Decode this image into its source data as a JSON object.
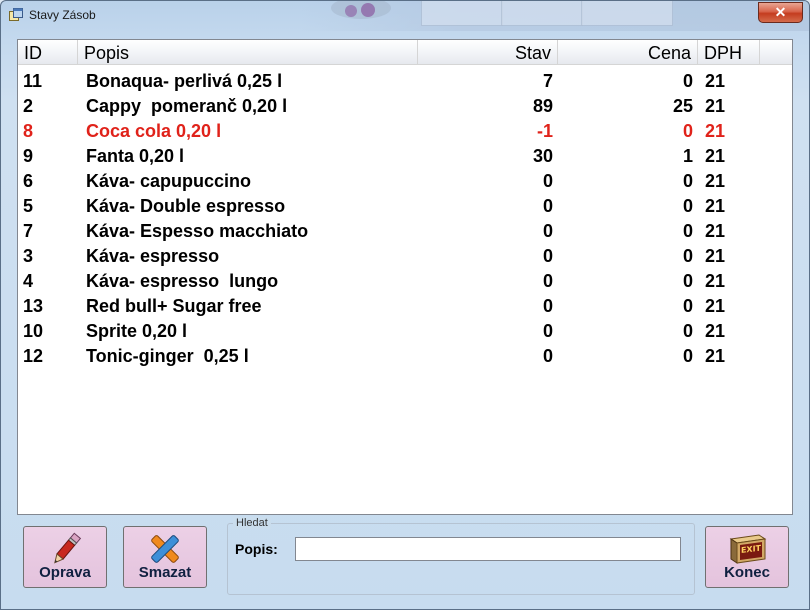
{
  "window": {
    "title": "Stavy Zásob",
    "close_glyph": "✕"
  },
  "table": {
    "headers": {
      "id": "ID",
      "popis": "Popis",
      "stav": "Stav",
      "cena": "Cena",
      "dph": "DPH"
    },
    "rows": [
      {
        "id": "11",
        "popis": "Bonaqua- perlivá 0,25 l",
        "stav": "7",
        "cena": "0",
        "dph": "21",
        "highlight": false
      },
      {
        "id": "2",
        "popis": "Cappy  pomeranč 0,20 l",
        "stav": "89",
        "cena": "25",
        "dph": "21",
        "highlight": false
      },
      {
        "id": "8",
        "popis": "Coca cola 0,20 l",
        "stav": "-1",
        "cena": "0",
        "dph": "21",
        "highlight": true
      },
      {
        "id": "9",
        "popis": "Fanta 0,20 l",
        "stav": "30",
        "cena": "1",
        "dph": "21",
        "highlight": false
      },
      {
        "id": "6",
        "popis": "Káva- capupuccino",
        "stav": "0",
        "cena": "0",
        "dph": "21",
        "highlight": false
      },
      {
        "id": "5",
        "popis": "Káva- Double espresso",
        "stav": "0",
        "cena": "0",
        "dph": "21",
        "highlight": false
      },
      {
        "id": "7",
        "popis": "Káva- Espesso macchiato",
        "stav": "0",
        "cena": "0",
        "dph": "21",
        "highlight": false
      },
      {
        "id": "3",
        "popis": "Káva- espresso",
        "stav": "0",
        "cena": "0",
        "dph": "21",
        "highlight": false
      },
      {
        "id": "4",
        "popis": "Káva- espresso  lungo",
        "stav": "0",
        "cena": "0",
        "dph": "21",
        "highlight": false
      },
      {
        "id": "13",
        "popis": "Red bull+ Sugar free",
        "stav": "0",
        "cena": "0",
        "dph": "21",
        "highlight": false
      },
      {
        "id": "10",
        "popis": "Sprite 0,20 l",
        "stav": "0",
        "cena": "0",
        "dph": "21",
        "highlight": false
      },
      {
        "id": "12",
        "popis": "Tonic-ginger  0,25 l",
        "stav": "0",
        "cena": "0",
        "dph": "21",
        "highlight": false
      }
    ]
  },
  "buttons": {
    "oprava": {
      "label": "Oprava",
      "icon": "pencil-icon"
    },
    "smazat": {
      "label": "Smazat",
      "icon": "delete-x-icon"
    },
    "konec": {
      "label": "Konec",
      "icon": "exit-sign-icon",
      "icon_text": "EXIT"
    }
  },
  "search": {
    "group_label": "Hledat",
    "field_label": "Popis:",
    "value": "",
    "placeholder": ""
  },
  "colors": {
    "highlight_row": "#e0221a",
    "button_bg": "#e4c3dd"
  }
}
